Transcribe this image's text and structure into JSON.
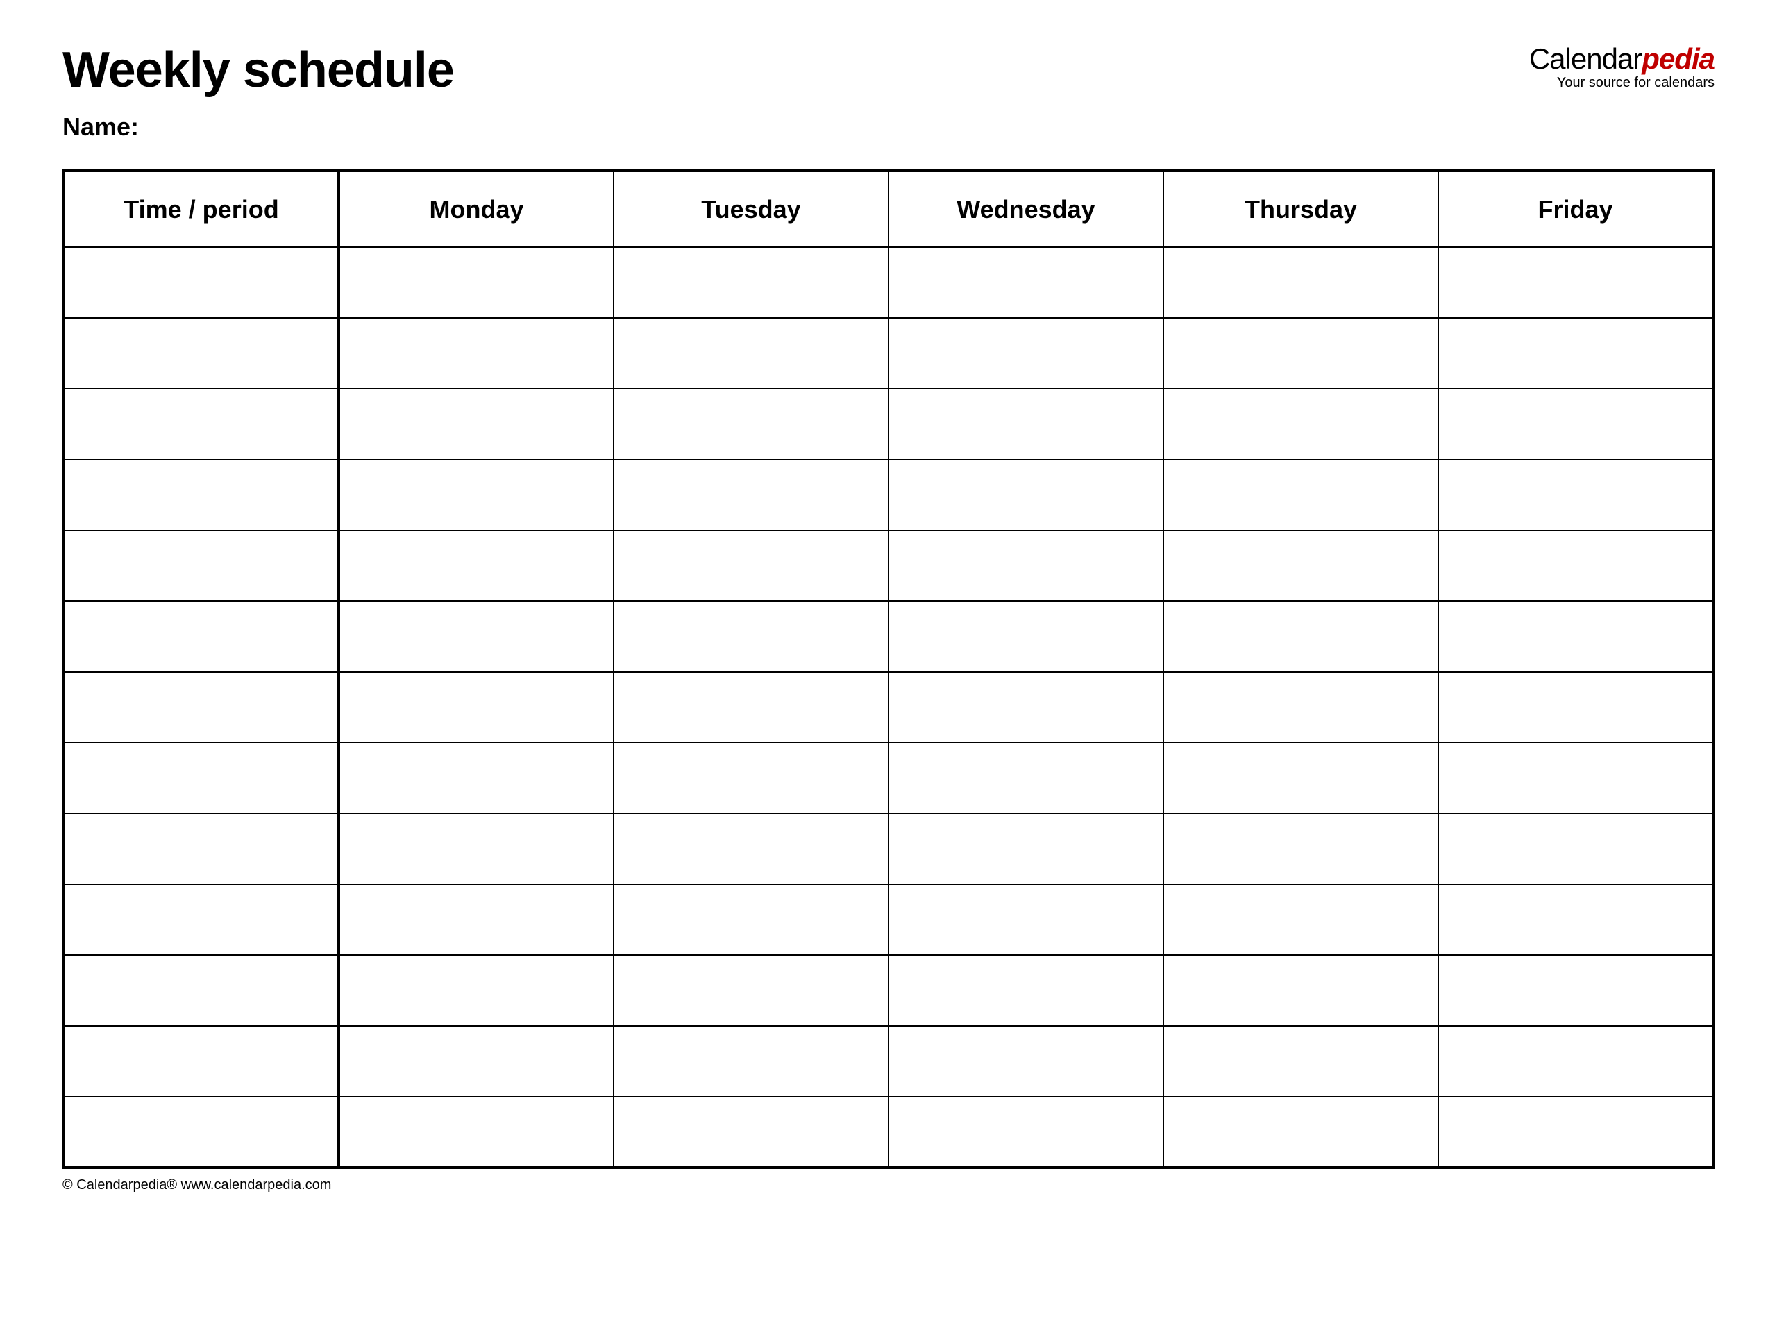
{
  "header": {
    "title": "Weekly schedule",
    "name_label": "Name:"
  },
  "brand": {
    "part1": "Calendar",
    "part2": "pedia",
    "tagline": "Your source for calendars"
  },
  "table": {
    "columns": [
      "Time / period",
      "Monday",
      "Tuesday",
      "Wednesday",
      "Thursday",
      "Friday"
    ],
    "row_count": 13
  },
  "footer": {
    "text": "© Calendarpedia®   www.calendarpedia.com"
  }
}
